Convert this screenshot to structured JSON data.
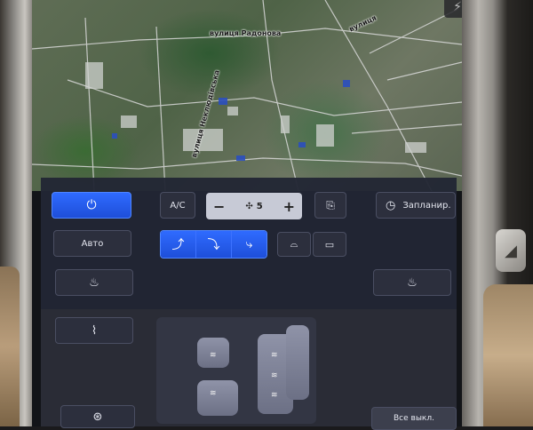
{
  "map": {
    "street_top": "вулиця Радонова",
    "street_side": "вулиця Неклюдівська",
    "street_right": "вулиця"
  },
  "climate": {
    "power_icon": "power-icon",
    "ac_label": "A/C",
    "fan_minus": "−",
    "fan_plus": "+",
    "fan_icon": "fan-icon",
    "fan_speed": "5",
    "recirc_icon": "recirculation-icon",
    "schedule_icon": "clock-icon",
    "schedule_label": "Запланир.",
    "auto_label": "Авто",
    "airflow_modes": [
      "face-airflow-icon",
      "face-feet-airflow-icon",
      "feet-airflow-icon"
    ],
    "front_defrost_icon": "front-defrost-icon",
    "rear_defrost_icon": "rear-defrost-icon",
    "seat_heat_left_icon": "seat-heater-icon",
    "seat_heat_right_icon": "seat-heater-icon",
    "steering_heat_icon": "steering-wheel-heater-icon",
    "wiper_heat_icon": "wiper-defrost-icon",
    "heat_symbol": "≋",
    "all_off_label": "Все выкл."
  },
  "accent_color": "#2f6bff"
}
